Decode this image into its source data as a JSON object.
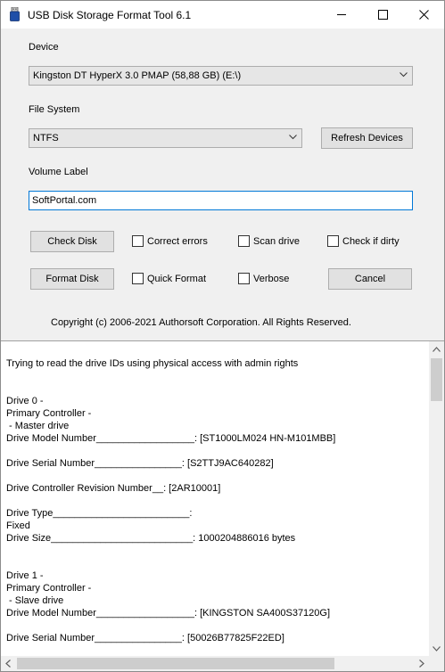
{
  "window": {
    "title": "USB Disk Storage Format Tool 6.1"
  },
  "device": {
    "label": "Device",
    "selected": "Kingston  DT HyperX 3.0  PMAP (58,88 GB) (E:\\)"
  },
  "file_system": {
    "label": "File System",
    "selected": "NTFS",
    "refresh_label": "Refresh Devices"
  },
  "volume_label": {
    "label": "Volume Label",
    "value": "SoftPortal.com"
  },
  "actions": {
    "check_disk": "Check Disk",
    "format_disk": "Format Disk",
    "cancel": "Cancel"
  },
  "options": {
    "correct_errors": "Correct errors",
    "scan_drive": "Scan drive",
    "check_if_dirty": "Check if dirty",
    "quick_format": "Quick Format",
    "verbose": "Verbose"
  },
  "copyright": "Copyright (c) 2006-2021 Authorsoft Corporation. All Rights Reserved.",
  "log": {
    "text": "Trying to read the drive IDs using physical access with admin rights\n\n\nDrive 0 -\nPrimary Controller -\n - Master drive\nDrive Model Number__________________: [ST1000LM024 HN-M101MBB]\n\nDrive Serial Number________________: [S2TTJ9AC640282]\n\nDrive Controller Revision Number__: [2AR10001]\n\nDrive Type_________________________:\nFixed\nDrive Size__________________________: 1000204886016 bytes\n\n\nDrive 1 -\nPrimary Controller -\n - Slave drive\nDrive Model Number__________________: [KINGSTON SA400S37120G]\n\nDrive Serial Number________________: [50026B77825F22ED]"
  },
  "icons": {
    "app": "usb-drive-icon",
    "minimize": "minimize-icon",
    "maximize": "maximize-icon",
    "close": "close-icon"
  }
}
